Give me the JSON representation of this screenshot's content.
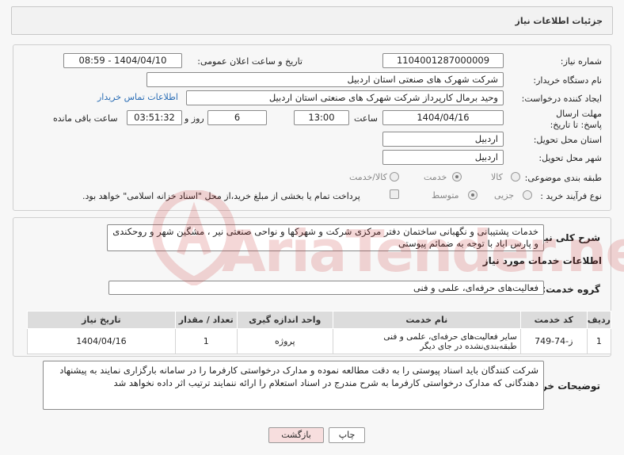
{
  "header": {
    "title": "جزئیات اطلاعات نیاز"
  },
  "form": {
    "need_number_label": "شماره نیاز:",
    "need_number": "1104001287000009",
    "announce_label": "تاریخ و ساعت اعلان عمومی:",
    "announce_value": "1404/04/10 - 08:59",
    "buyer_label": "نام دستگاه خریدار:",
    "buyer_value": "شرکت شهرک های صنعتی استان اردبیل",
    "creator_label": "ایجاد کننده درخواست:",
    "creator_value": "وحید برمال کارپرداز شرکت شهرک های صنعتی استان اردبیل",
    "contact_link": "اطلاعات تماس خریدار",
    "deadline_label": "مهلت ارسال پاسخ: تا تاریخ:",
    "deadline_date": "1404/04/16",
    "time_label": "ساعت",
    "deadline_time": "13:00",
    "days_value": "6",
    "days_label": "روز و",
    "remaining_time": "03:51:32",
    "remaining_label": "ساعت باقی مانده",
    "province_label": "استان محل تحویل:",
    "province_value": "اردبیل",
    "city_label": "شهر محل تحویل:",
    "city_value": "اردبیل",
    "category_label": "طبقه بندی موضوعی:",
    "category_options": [
      "کالا",
      "خدمت",
      "کالا/خدمت"
    ],
    "category_selected": "خدمت",
    "process_label": "نوع فرآیند خرید :",
    "process_options": [
      "جزیی",
      "متوسط"
    ],
    "process_selected": "متوسط",
    "payment_note": "پرداخت تمام یا بخشی از مبلغ خرید،از محل \"اسناد خزانه اسلامی\" خواهد بود."
  },
  "description": {
    "label": "شرح کلی نیاز:",
    "value": "خدمات پشتیبانی و نگهبانی ساختمان دفتر مرکزی شرکت و شهرکها و نواحی صنعتی نیر ، مشگین شهر و روحکندی و پارس اباد با توجه به ضمائم پیوستی"
  },
  "services": {
    "heading": "اطلاعات خدمات مورد نیاز",
    "group_label": "گروه خدمت:",
    "group_value": "فعالیت‌های حرفه‌ای، علمی و فنی",
    "columns": [
      "ردیف",
      "کد خدمت",
      "نام خدمت",
      "واحد اندازه گیری",
      "تعداد / مقدار",
      "تاریخ نیاز"
    ],
    "rows": [
      {
        "index": "1",
        "code": "ز-74-749",
        "name": "سایر فعالیت‌های حرفه‌ای، علمی و فنی طبقه‌بندی‌نشده در جای دیگر",
        "unit": "پروژه",
        "qty": "1",
        "date": "1404/04/16"
      }
    ]
  },
  "buyer_notes": {
    "label": "توضیحات خریدار:",
    "value": "شرکت کنندگان باید اسناد پیوستی را به دقت مطالعه نموده و مدارک درخواستی کارفرما را در سامانه بارگزاری نمایند به پیشنهاد دهندگانی که مدارک درخواستی کارفرما به شرح مندرج در اسناد استعلام را ارائه ننمایند ترتیب اثر داده نخواهد شد"
  },
  "buttons": {
    "print": "چاپ",
    "back": "بازگشت"
  },
  "watermark": {
    "text": "AriaTender.neT"
  },
  "colors": {
    "link": "#2a6db5",
    "back_button": "#f7dede",
    "watermark": "#c72a2a"
  }
}
